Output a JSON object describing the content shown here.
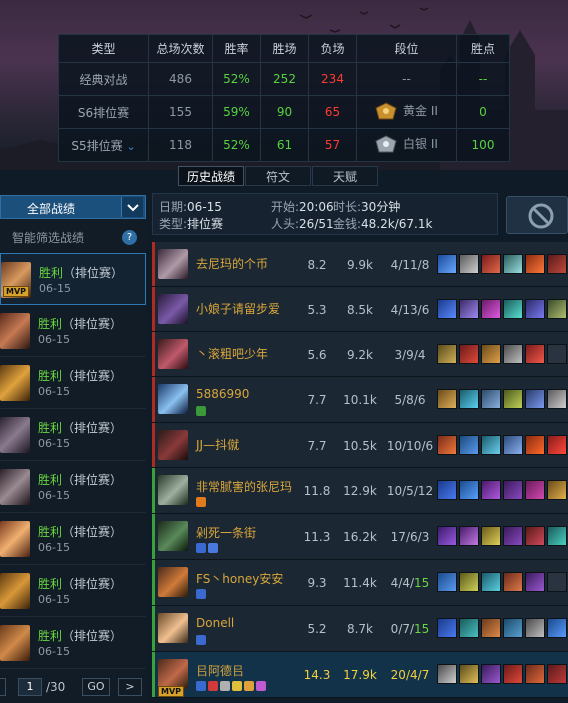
{
  "stats_table": {
    "headers": [
      "类型",
      "总场次数",
      "胜率",
      "胜场",
      "负场",
      "段位",
      "胜点"
    ],
    "rows": [
      {
        "type": "经典对战",
        "total": "486",
        "winrate": "52%",
        "wins": "252",
        "losses": "234",
        "tier": "--",
        "points": "--"
      },
      {
        "type": "S6排位赛",
        "total": "155",
        "winrate": "59%",
        "wins": "90",
        "losses": "65",
        "tier": "黄金 II",
        "points": "0"
      },
      {
        "type": "S5排位赛",
        "total": "118",
        "winrate": "52%",
        "wins": "61",
        "losses": "57",
        "tier": "白银 II",
        "points": "100"
      }
    ]
  },
  "tabs": [
    "历史战绩",
    "符文",
    "天赋"
  ],
  "left_panel": {
    "all_button": "全部战绩",
    "smart_filter": "智能筛选战绩",
    "help": "?",
    "mvp_label": "MVP",
    "games": [
      {
        "result": "胜利",
        "mode": "（排位赛）",
        "date": "06-15"
      },
      {
        "result": "胜利",
        "mode": "（排位赛）",
        "date": "06-15"
      },
      {
        "result": "胜利",
        "mode": "（排位赛）",
        "date": "06-15"
      },
      {
        "result": "胜利",
        "mode": "（排位赛）",
        "date": "06-15"
      },
      {
        "result": "胜利",
        "mode": "（排位赛）",
        "date": "06-15"
      },
      {
        "result": "胜利",
        "mode": "（排位赛）",
        "date": "06-15"
      },
      {
        "result": "胜利",
        "mode": "（排位赛）",
        "date": "06-15"
      },
      {
        "result": "胜利",
        "mode": "（排位赛）",
        "date": "06-15"
      }
    ],
    "pager": {
      "page": "1",
      "total": "/30",
      "go": "GO",
      "next": ">"
    }
  },
  "match_info": {
    "date_label": "日期:",
    "date": "06-15",
    "start_label": "开始:",
    "start": "20:06",
    "duration_label": "时长:",
    "duration": "30分钟",
    "type_label": "类型:",
    "type": "排位赛",
    "kills_label": "人头:",
    "kills": "26/51",
    "gold_label": "金钱:",
    "gold": "48.2k/67.1k"
  },
  "players": [
    {
      "name": "去尼玛的个币",
      "score": "8.2",
      "gold": "9.9k",
      "k": "4",
      "d": "11",
      "a": "8",
      "team": "red"
    },
    {
      "name": "小娘子请留步爱",
      "score": "5.3",
      "gold": "8.5k",
      "k": "4",
      "d": "13",
      "a": "6",
      "team": "red"
    },
    {
      "name": "丶滚粗吧少年",
      "score": "5.6",
      "gold": "9.2k",
      "k": "3",
      "d": "9",
      "a": "4",
      "team": "red"
    },
    {
      "name": "5886990",
      "score": "7.7",
      "gold": "10.1k",
      "k": "5",
      "d": "8",
      "a": "6",
      "team": "red"
    },
    {
      "name": "JJ—抖僦",
      "score": "7.7",
      "gold": "10.5k",
      "k": "10",
      "d": "10",
      "a": "6",
      "team": "red"
    },
    {
      "name": "非常腻害的张尼玛",
      "score": "11.8",
      "gold": "12.9k",
      "k": "10",
      "d": "5",
      "a": "12",
      "team": "green"
    },
    {
      "name": "剁死一条街",
      "score": "11.3",
      "gold": "16.2k",
      "k": "17",
      "d": "6",
      "a": "3",
      "team": "green"
    },
    {
      "name": "FS丶honey安安",
      "score": "9.3",
      "gold": "11.4k",
      "k": "4",
      "d": "4",
      "a": "15",
      "team": "green"
    },
    {
      "name": "Donell",
      "score": "5.2",
      "gold": "8.7k",
      "k": "0",
      "d": "7",
      "a": "15",
      "team": "green"
    },
    {
      "name": "㠯阿德㠯",
      "score": "14.3",
      "gold": "17.9k",
      "k": "20",
      "d": "4",
      "a": "7",
      "team": "green",
      "me": true
    }
  ],
  "colors": {
    "win_green": "#57d33f",
    "loss_red": "#ff3b30",
    "accent_blue": "#1b4f7c",
    "gold_name": "#d8a63b"
  }
}
